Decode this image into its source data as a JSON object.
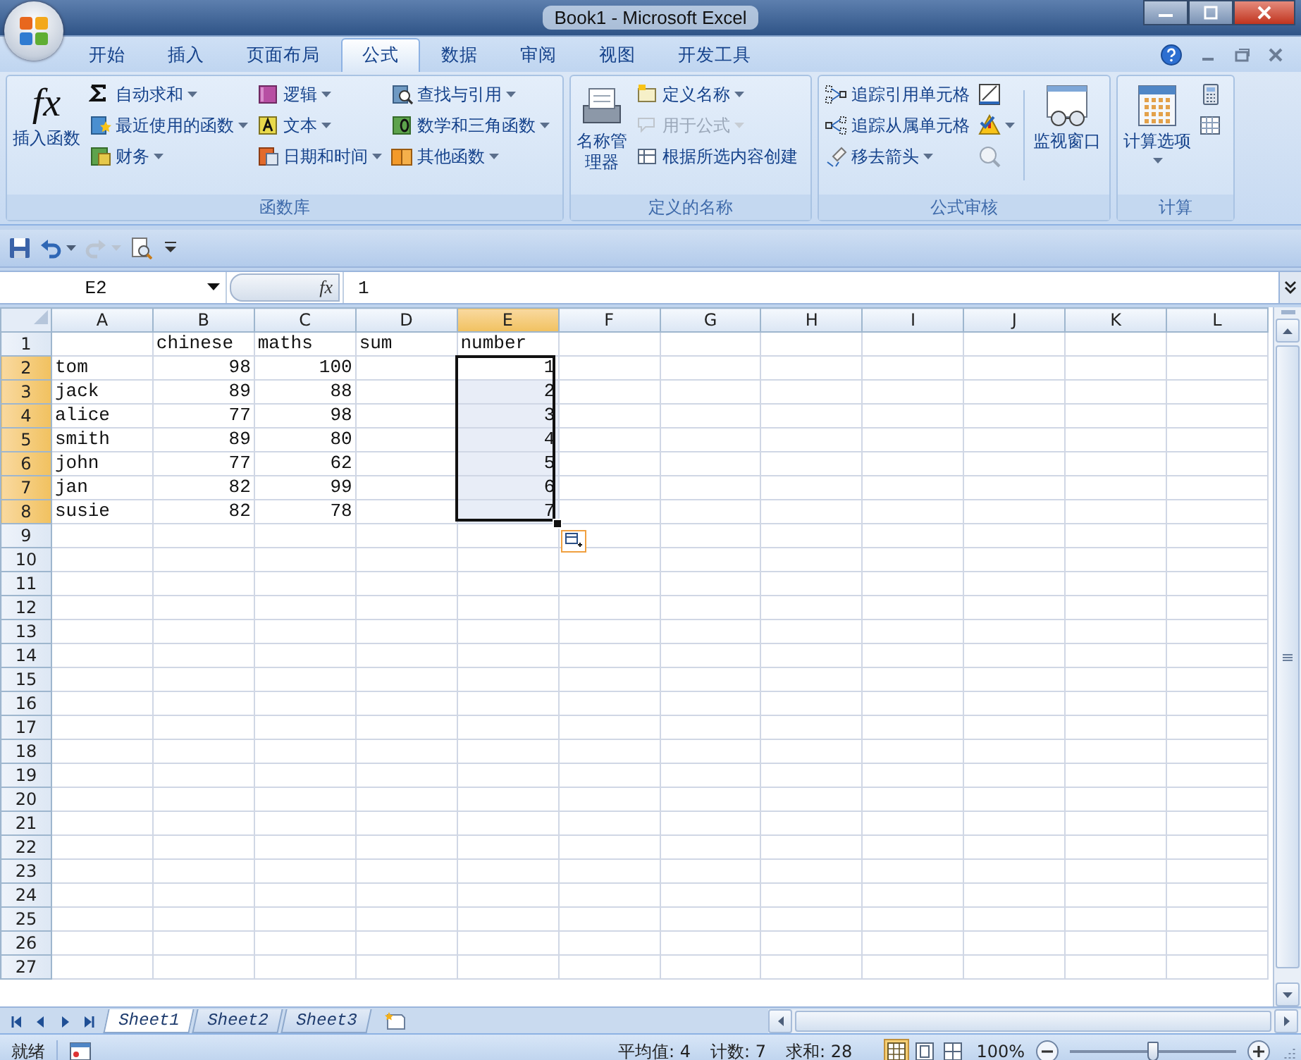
{
  "window": {
    "title": "Book1 - Microsoft Excel"
  },
  "tabs": [
    {
      "label": "开始",
      "selected": false
    },
    {
      "label": "插入",
      "selected": false
    },
    {
      "label": "页面布局",
      "selected": false
    },
    {
      "label": "公式",
      "selected": true
    },
    {
      "label": "数据",
      "selected": false
    },
    {
      "label": "审阅",
      "selected": false
    },
    {
      "label": "视图",
      "selected": false
    },
    {
      "label": "开发工具",
      "selected": false
    }
  ],
  "ribbon_groups": [
    {
      "label": "函数库",
      "large": [
        {
          "label": "插入函数",
          "icon_text": "fx",
          "dropdown": false
        }
      ],
      "columns": [
        [
          {
            "label": "自动求和",
            "dropdown": true,
            "disabled": false
          },
          {
            "label": "最近使用的函数",
            "dropdown": true,
            "disabled": false
          },
          {
            "label": "财务",
            "dropdown": true,
            "disabled": false
          }
        ],
        [
          {
            "label": "逻辑",
            "dropdown": true,
            "disabled": false
          },
          {
            "label": "文本",
            "dropdown": true,
            "disabled": false
          },
          {
            "label": "日期和时间",
            "dropdown": true,
            "disabled": false
          }
        ],
        [
          {
            "label": "查找与引用",
            "dropdown": true,
            "disabled": false
          },
          {
            "label": "数学和三角函数",
            "dropdown": true,
            "disabled": false
          },
          {
            "label": "其他函数",
            "dropdown": true,
            "disabled": false
          }
        ]
      ]
    },
    {
      "label": "定义的名称",
      "large": [
        {
          "label": "名称管理器",
          "dropdown": false
        }
      ],
      "columns": [
        [
          {
            "label": "定义名称",
            "dropdown": true,
            "disabled": false
          },
          {
            "label": "用于公式",
            "dropdown": true,
            "disabled": true
          },
          {
            "label": "根据所选内容创建",
            "dropdown": false,
            "disabled": false
          }
        ]
      ]
    },
    {
      "label": "公式审核",
      "columns": [
        [
          {
            "label": "追踪引用单元格",
            "dropdown": false,
            "disabled": false
          },
          {
            "label": "追踪从属单元格",
            "dropdown": false,
            "disabled": false
          },
          {
            "label": "移去箭头",
            "dropdown": true,
            "disabled": false
          }
        ],
        [
          {
            "dropdown": false,
            "disabled": false
          },
          {
            "dropdown": true,
            "disabled": false
          },
          {
            "dropdown": false,
            "disabled": false
          }
        ]
      ],
      "large_after": [
        {
          "label": "监视窗口",
          "dropdown": false
        }
      ]
    },
    {
      "label": "计算",
      "large": [
        {
          "label": "计算选项",
          "dropdown": true
        }
      ],
      "columns": [
        [
          {
            "dropdown": false,
            "disabled": false
          },
          {
            "dropdown": false,
            "disabled": false
          }
        ]
      ]
    }
  ],
  "quick_access": [
    {
      "kind": "save",
      "dropdown": false,
      "disabled": false
    },
    {
      "kind": "undo",
      "dropdown": true,
      "disabled": false
    },
    {
      "kind": "redo",
      "dropdown": true,
      "disabled": true
    },
    {
      "kind": "preview",
      "dropdown": false,
      "disabled": false
    },
    {
      "kind": "customize",
      "dropdown": false,
      "disabled": false
    }
  ],
  "formula_bar": {
    "name_box": "E2",
    "fx": "fx",
    "value": "1"
  },
  "columns": [
    {
      "label": "A",
      "selected": false
    },
    {
      "label": "B",
      "selected": false
    },
    {
      "label": "C",
      "selected": false
    },
    {
      "label": "D",
      "selected": false
    },
    {
      "label": "E",
      "selected": true
    },
    {
      "label": "F",
      "selected": false
    },
    {
      "label": "G",
      "selected": false
    },
    {
      "label": "H",
      "selected": false
    },
    {
      "label": "I",
      "selected": false
    },
    {
      "label": "J",
      "selected": false
    },
    {
      "label": "K",
      "selected": false
    },
    {
      "label": "L",
      "selected": false
    }
  ],
  "rows": [
    {
      "label": "1",
      "selected": false,
      "cells": [
        null,
        {
          "text": "chinese",
          "kind": "text"
        },
        {
          "text": "maths",
          "kind": "text"
        },
        {
          "text": "sum",
          "kind": "text"
        },
        {
          "text": "number",
          "kind": "text"
        }
      ]
    },
    {
      "label": "2",
      "selected": true,
      "cells": [
        {
          "text": "tom",
          "kind": "text"
        },
        {
          "text": "98",
          "kind": "number"
        },
        {
          "text": "100",
          "kind": "number"
        },
        null,
        {
          "text": "1",
          "kind": "number"
        }
      ]
    },
    {
      "label": "3",
      "selected": true,
      "cells": [
        {
          "text": "jack",
          "kind": "text"
        },
        {
          "text": "89",
          "kind": "number"
        },
        {
          "text": "88",
          "kind": "number"
        },
        null,
        {
          "text": "2",
          "kind": "number"
        }
      ]
    },
    {
      "label": "4",
      "selected": true,
      "cells": [
        {
          "text": "alice",
          "kind": "text"
        },
        {
          "text": "77",
          "kind": "number"
        },
        {
          "text": "98",
          "kind": "number"
        },
        null,
        {
          "text": "3",
          "kind": "number"
        }
      ]
    },
    {
      "label": "5",
      "selected": true,
      "cells": [
        {
          "text": "smith",
          "kind": "text"
        },
        {
          "text": "89",
          "kind": "number"
        },
        {
          "text": "80",
          "kind": "number"
        },
        null,
        {
          "text": "4",
          "kind": "number"
        }
      ]
    },
    {
      "label": "6",
      "selected": true,
      "cells": [
        {
          "text": "john",
          "kind": "text"
        },
        {
          "text": "77",
          "kind": "number"
        },
        {
          "text": "62",
          "kind": "number"
        },
        null,
        {
          "text": "5",
          "kind": "number"
        }
      ]
    },
    {
      "label": "7",
      "selected": true,
      "cells": [
        {
          "text": "jan",
          "kind": "text"
        },
        {
          "text": "82",
          "kind": "number"
        },
        {
          "text": "99",
          "kind": "number"
        },
        null,
        {
          "text": "6",
          "kind": "number"
        }
      ]
    },
    {
      "label": "8",
      "selected": true,
      "cells": [
        {
          "text": "susie",
          "kind": "text"
        },
        {
          "text": "82",
          "kind": "number"
        },
        {
          "text": "78",
          "kind": "number"
        },
        null,
        {
          "text": "7",
          "kind": "number"
        }
      ]
    },
    {
      "label": "9",
      "selected": false
    },
    {
      "label": "10",
      "selected": false
    },
    {
      "label": "11",
      "selected": false
    },
    {
      "label": "12",
      "selected": false
    },
    {
      "label": "13",
      "selected": false
    },
    {
      "label": "14",
      "selected": false
    },
    {
      "label": "15",
      "selected": false
    },
    {
      "label": "16",
      "selected": false
    },
    {
      "label": "17",
      "selected": false
    },
    {
      "label": "18",
      "selected": false
    },
    {
      "label": "19",
      "selected": false
    },
    {
      "label": "20",
      "selected": false
    },
    {
      "label": "21",
      "selected": false
    },
    {
      "label": "22",
      "selected": false
    },
    {
      "label": "23",
      "selected": false
    },
    {
      "label": "24",
      "selected": false
    },
    {
      "label": "25",
      "selected": false
    },
    {
      "label": "26",
      "selected": false
    },
    {
      "label": "27",
      "selected": false
    }
  ],
  "sheet_tabs": [
    {
      "label": "Sheet1",
      "selected": true
    },
    {
      "label": "Sheet2",
      "selected": false
    },
    {
      "label": "Sheet3",
      "selected": false
    }
  ],
  "status_bar": {
    "mode": "就绪",
    "stats": [
      "平均值: 4",
      "计数: 7",
      "求和: 28"
    ],
    "zoom": "100%",
    "zoom_slider": {
      "level": 0.5
    }
  }
}
